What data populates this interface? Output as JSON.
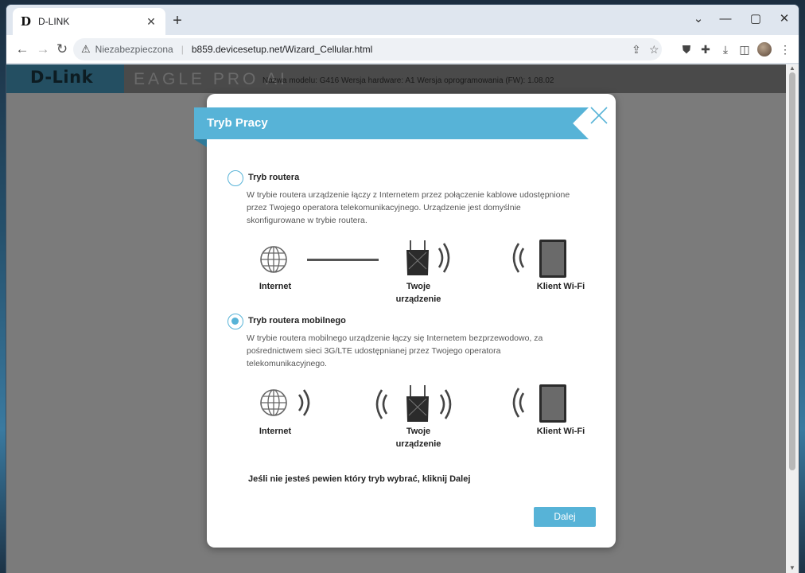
{
  "browser": {
    "tab_title": "D-LINK",
    "favicon": "D",
    "new_tab_label": "+",
    "security_label": "Niezabezpieczona",
    "url": "b859.devicesetup.net/Wizard_Cellular.html"
  },
  "site": {
    "logo": "D-Link",
    "product_line": "EAGLE PRO AI",
    "model_info": "Nazwa modelu: G416 Wersja hardware: A1 Wersja oprogramowania (FW): 1.08.02"
  },
  "modal": {
    "title": "Tryb Pracy",
    "options": [
      {
        "label": "Tryb routera",
        "description": "W trybie routera urządzenie łączy z Internetem przez połączenie kablowe udostępnione przez Twojego operatora telekomunikacyjnego. Urządzenie jest domyślnie skonfigurowane w trybie routera.",
        "checked": false
      },
      {
        "label": "Tryb routera mobilnego",
        "description": "W trybie routera mobilnego urządzenie łączy się Internetem bezprzewodowo, za pośrednictwem sieci 3G/LTE udostępnianej przez Twojego operatora telekomunikacyjnego.",
        "checked": true
      }
    ],
    "diagram_labels": {
      "internet": "Internet",
      "device_line1": "Twoje",
      "device_line2": "urządzenie",
      "client": "Klient Wi-Fi"
    },
    "hint": "Jeśli nie jesteś pewien który tryb wybrać, kliknij Dalej",
    "next_label": "Dalej"
  },
  "colors": {
    "accent": "#57b3d7",
    "overlay": "#7b7b7b"
  }
}
